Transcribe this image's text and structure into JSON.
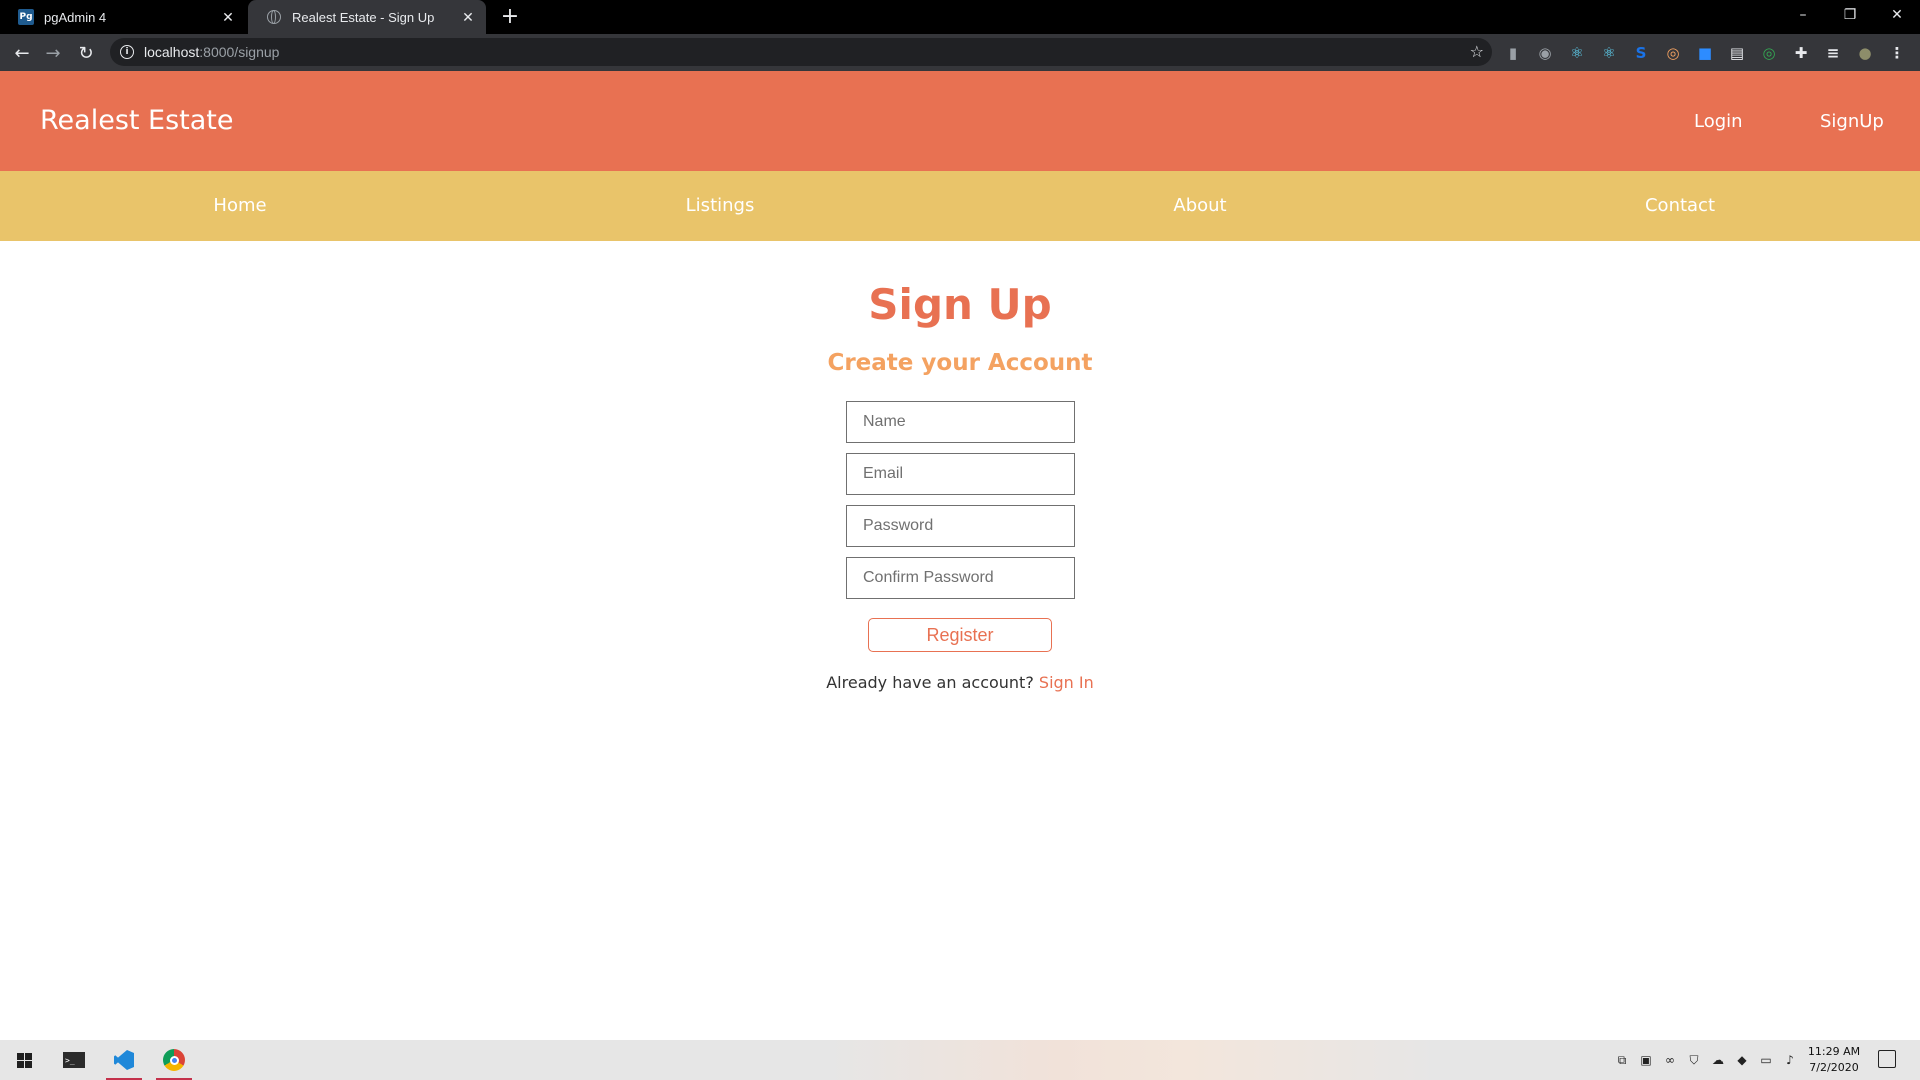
{
  "browser": {
    "tabs": [
      {
        "title": "pgAdmin 4",
        "favicon": "pgadmin-icon",
        "favicon_text": "Pg",
        "active": false
      },
      {
        "title": "Realest Estate - Sign Up",
        "favicon": "globe-icon",
        "active": true
      }
    ],
    "new_tab_glyph": "+",
    "close_glyph": "✕",
    "window_controls": {
      "minimize": "–",
      "restore": "❐",
      "close": "✕"
    },
    "nav": {
      "back": "←",
      "forward": "→",
      "reload": "↻"
    },
    "address": {
      "host": "localhost",
      "path": ":8000/signup",
      "info_glyph": "i",
      "star_glyph": "☆"
    },
    "extensions": [
      {
        "name": "analytics-extension-icon",
        "glyph": "▮",
        "color": "#9aa0a6"
      },
      {
        "name": "camera-extension-icon",
        "glyph": "◉",
        "color": "#9aa0a6"
      },
      {
        "name": "react-devtools-icon",
        "glyph": "⚛",
        "color": "#61dafb"
      },
      {
        "name": "react-devtools-alt-icon",
        "glyph": "⚛",
        "color": "#61dafb"
      },
      {
        "name": "s-extension-icon",
        "glyph": "S",
        "color": "#1a73e8"
      },
      {
        "name": "owl-extension-icon",
        "glyph": "◎",
        "color": "#f4a261"
      },
      {
        "name": "zoom-extension-icon",
        "glyph": "■",
        "color": "#2d8cff"
      },
      {
        "name": "calendar-extension-icon",
        "glyph": "▤",
        "color": "#e8eaed"
      },
      {
        "name": "circle-extension-icon",
        "glyph": "◎",
        "color": "#34a853"
      },
      {
        "name": "puzzle-extensions-icon",
        "glyph": "✚",
        "color": "#e8eaed"
      },
      {
        "name": "media-queue-icon",
        "glyph": "≡",
        "color": "#e8eaed"
      },
      {
        "name": "profile-avatar-icon",
        "glyph": "●",
        "color": "#8d8d6a"
      },
      {
        "name": "menu-kebab-icon",
        "glyph": "⋮",
        "color": "#e8eaed"
      }
    ]
  },
  "site": {
    "brand": "Realest Estate",
    "auth": {
      "login": "Login",
      "signup": "SignUp"
    },
    "nav": [
      "Home",
      "Listings",
      "About",
      "Contact"
    ],
    "colors": {
      "primary": "#e87152",
      "secondary": "#e9c46a",
      "accent": "#f4a261"
    }
  },
  "signup": {
    "title": "Sign Up",
    "subtitle": "Create your Account",
    "fields": {
      "name": {
        "placeholder": "Name",
        "value": ""
      },
      "email": {
        "placeholder": "Email",
        "value": ""
      },
      "password": {
        "placeholder": "Password",
        "value": ""
      },
      "confirm_password": {
        "placeholder": "Confirm Password",
        "value": ""
      }
    },
    "register_label": "Register",
    "already_text": "Already have an account?",
    "signin_label": "Sign In"
  },
  "taskbar": {
    "apps": [
      {
        "name": "windows-terminal-icon",
        "active": false
      },
      {
        "name": "vscode-icon",
        "active": true
      },
      {
        "name": "chrome-icon",
        "active": true
      }
    ],
    "tray": [
      {
        "name": "network-share-icon",
        "glyph": "⧉"
      },
      {
        "name": "app-tray-icon",
        "glyph": "▣"
      },
      {
        "name": "link-tray-icon",
        "glyph": "∞"
      },
      {
        "name": "shield-icon",
        "glyph": "⛉"
      },
      {
        "name": "cloud-icon",
        "glyph": "☁"
      },
      {
        "name": "dropbox-icon",
        "glyph": "◆"
      },
      {
        "name": "network-icon",
        "glyph": "▭"
      },
      {
        "name": "volume-icon",
        "glyph": "♪"
      }
    ],
    "time": "11:29 AM",
    "date": "7/2/2020"
  }
}
